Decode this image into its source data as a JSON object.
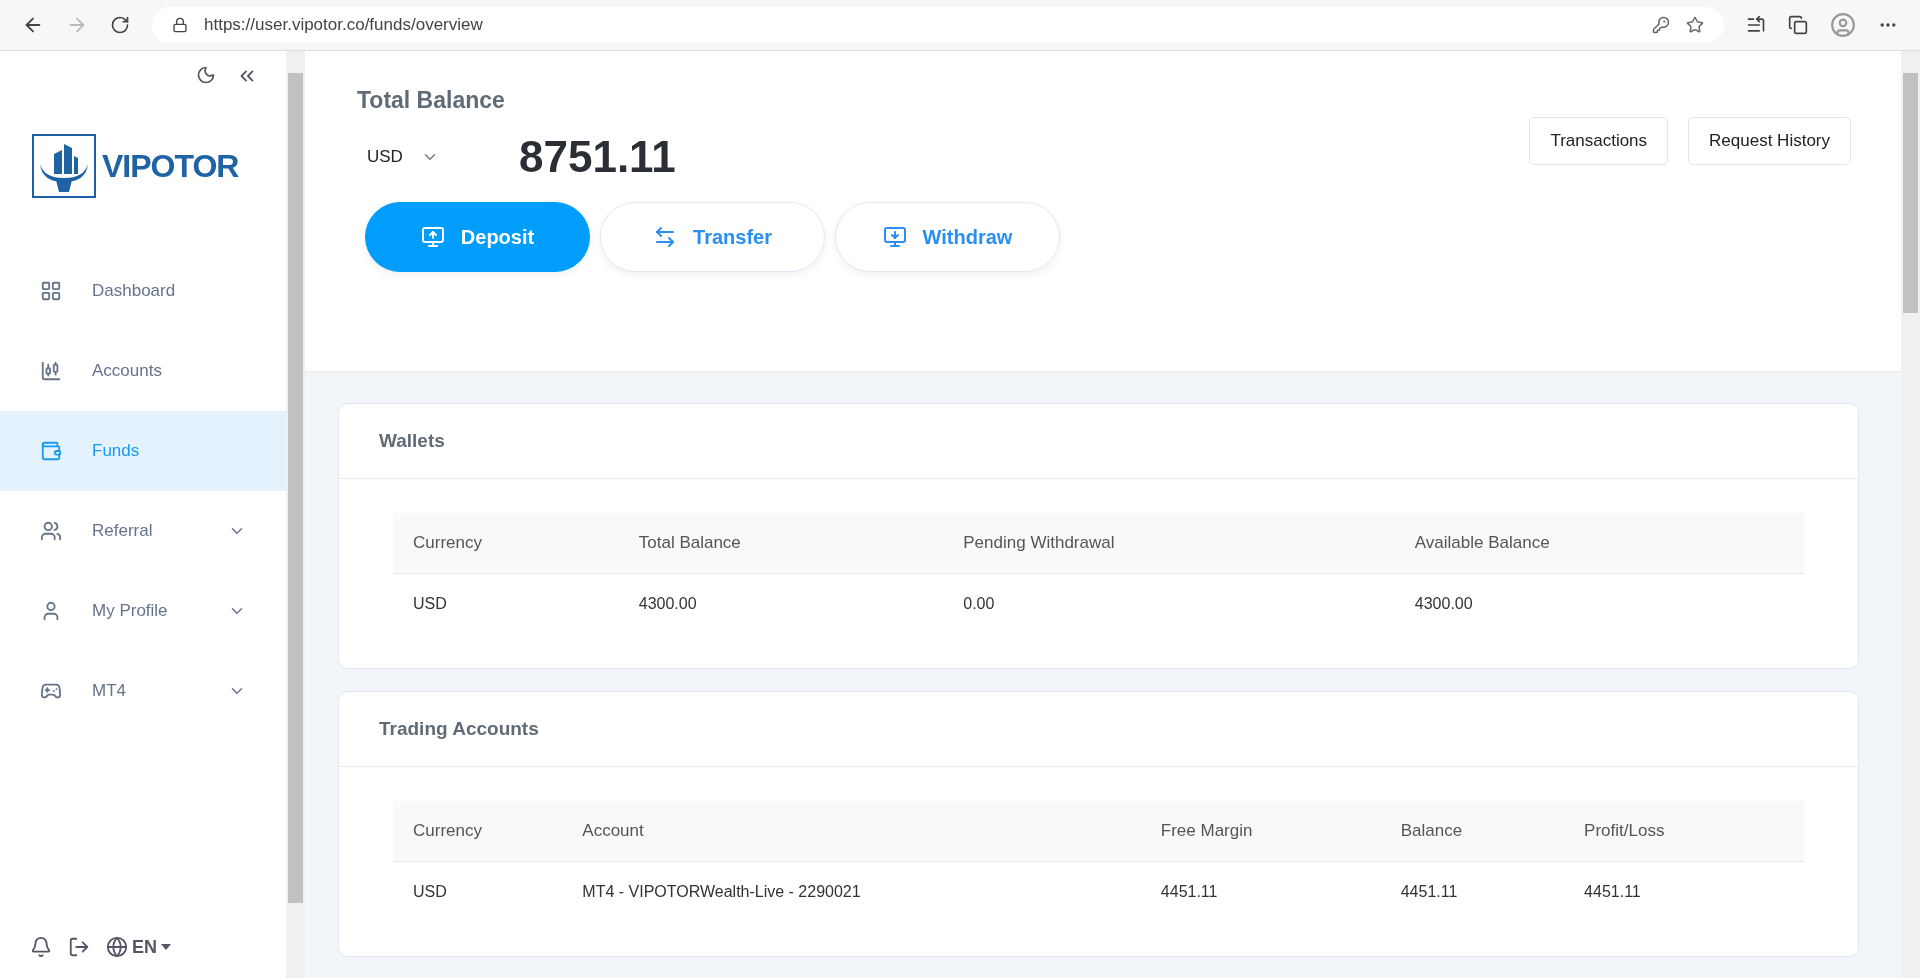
{
  "browser": {
    "url": "https://user.vipotor.co/funds/overview"
  },
  "sidebar": {
    "logo": "VIPOTOR",
    "items": [
      {
        "label": "Dashboard",
        "kind": "link",
        "selected": false
      },
      {
        "label": "Accounts",
        "kind": "link",
        "selected": false
      },
      {
        "label": "Funds",
        "kind": "link",
        "selected": true
      },
      {
        "label": "Referral",
        "kind": "group",
        "selected": false
      },
      {
        "label": "My Profile",
        "kind": "group",
        "selected": false
      },
      {
        "label": "MT4",
        "kind": "group",
        "selected": false
      }
    ],
    "language": "EN"
  },
  "balance": {
    "title": "Total Balance",
    "currency": "USD",
    "amount": "8751.11",
    "actions": [
      {
        "label": "Deposit",
        "selected": true
      },
      {
        "label": "Transfer",
        "selected": false
      },
      {
        "label": "Withdraw",
        "selected": false
      }
    ],
    "links": [
      "Transactions",
      "Request History"
    ]
  },
  "wallets": {
    "title": "Wallets",
    "columns": [
      "Currency",
      "Total Balance",
      "Pending Withdrawal",
      "Available Balance"
    ],
    "rows": [
      [
        "USD",
        "4300.00",
        "0.00",
        "4300.00"
      ]
    ]
  },
  "trading_accounts": {
    "title": "Trading Accounts",
    "columns": [
      "Currency",
      "Account",
      "Free Margin",
      "Balance",
      "Profit/Loss"
    ],
    "rows": [
      [
        "USD",
        "MT4 - VIPOTORWealth-Live - 2290021",
        "4451.11",
        "4451.11",
        "4451.11"
      ]
    ]
  }
}
